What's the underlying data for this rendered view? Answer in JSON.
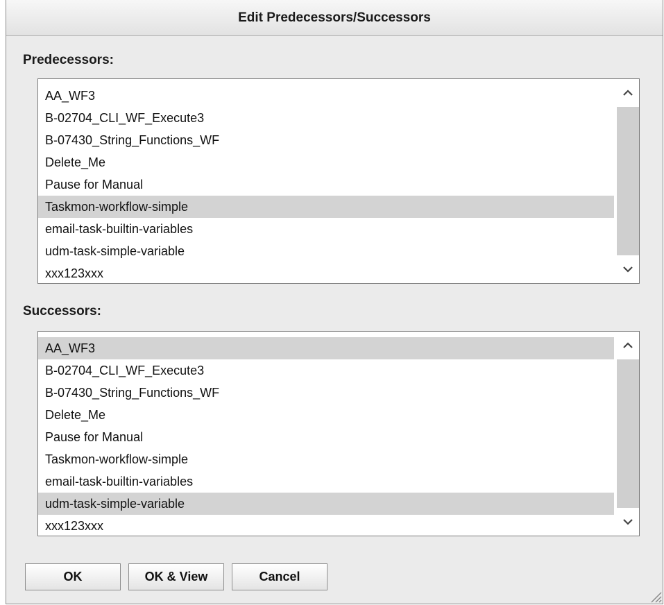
{
  "dialog": {
    "title": "Edit Predecessors/Successors"
  },
  "predecessors": {
    "label": "Predecessors:",
    "items": [
      "AA_WF3",
      "B-02704_CLI_WF_Execute3",
      "B-07430_String_Functions_WF",
      "Delete_Me",
      "Pause for Manual",
      "Taskmon-workflow-simple",
      "email-task-builtin-variables",
      "udm-task-simple-variable",
      "xxx123xxx"
    ],
    "selected": "Taskmon-workflow-simple"
  },
  "successors": {
    "label": "Successors:",
    "items": [
      "AA_WF3",
      "B-02704_CLI_WF_Execute3",
      "B-07430_String_Functions_WF",
      "Delete_Me",
      "Pause for Manual",
      "Taskmon-workflow-simple",
      "email-task-builtin-variables",
      "udm-task-simple-variable",
      "xxx123xxx"
    ],
    "selected": [
      "AA_WF3",
      "udm-task-simple-variable"
    ]
  },
  "buttons": {
    "ok": "OK",
    "ok_view": "OK & View",
    "cancel": "Cancel"
  },
  "icons": {
    "scroll_up": "chevron-up-icon",
    "scroll_down": "chevron-down-icon",
    "resize": "resize-grip-icon"
  }
}
